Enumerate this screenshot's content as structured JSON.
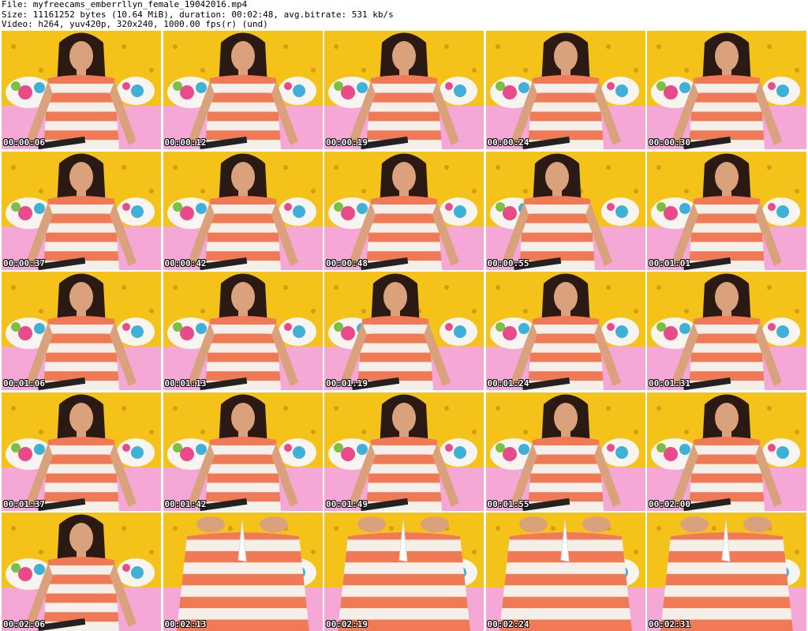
{
  "header": {
    "file": "File: myfreecams_emberrllyn_female_19042016.mp4",
    "size": "Size: 11161252 bytes (10.64 MiB), duration: 00:02:48, avg.bitrate: 531 kb/s",
    "video": "Video: h264, yuv420p, 320x240, 1000.00 fps(r) (und)"
  },
  "colors": {
    "background_wall": "#f5c21a",
    "bed": "#f5a8d6",
    "dress_stripe": "#f07a55",
    "dress_white": "#f4efe8",
    "hair": "#2b1a14",
    "skin": "#d9a17c"
  },
  "thumbnails": [
    {
      "time": "00:00:06",
      "scene": "sitting"
    },
    {
      "time": "00:00:12",
      "scene": "sitting"
    },
    {
      "time": "00:00:19",
      "scene": "sitting"
    },
    {
      "time": "00:00:24",
      "scene": "sitting"
    },
    {
      "time": "00:00:30",
      "scene": "sitting"
    },
    {
      "time": "00:00:37",
      "scene": "sitting"
    },
    {
      "time": "00:00:42",
      "scene": "sitting"
    },
    {
      "time": "00:00:48",
      "scene": "sitting"
    },
    {
      "time": "00:00:55",
      "scene": "leaning"
    },
    {
      "time": "00:01:01",
      "scene": "sitting"
    },
    {
      "time": "00:01:06",
      "scene": "sitting"
    },
    {
      "time": "00:01:13",
      "scene": "sitting"
    },
    {
      "time": "00:01:19",
      "scene": "leaning"
    },
    {
      "time": "00:01:24",
      "scene": "sitting"
    },
    {
      "time": "00:01:31",
      "scene": "sitting"
    },
    {
      "time": "00:01:37",
      "scene": "sitting"
    },
    {
      "time": "00:01:42",
      "scene": "sitting"
    },
    {
      "time": "00:01:49",
      "scene": "sitting"
    },
    {
      "time": "00:01:55",
      "scene": "sitting"
    },
    {
      "time": "00:02:00",
      "scene": "sitting"
    },
    {
      "time": "00:02:06",
      "scene": "sitting"
    },
    {
      "time": "00:02:13",
      "scene": "closeup"
    },
    {
      "time": "00:02:19",
      "scene": "closeup"
    },
    {
      "time": "00:02:24",
      "scene": "closeup"
    },
    {
      "time": "00:02:31",
      "scene": "closeup"
    }
  ]
}
